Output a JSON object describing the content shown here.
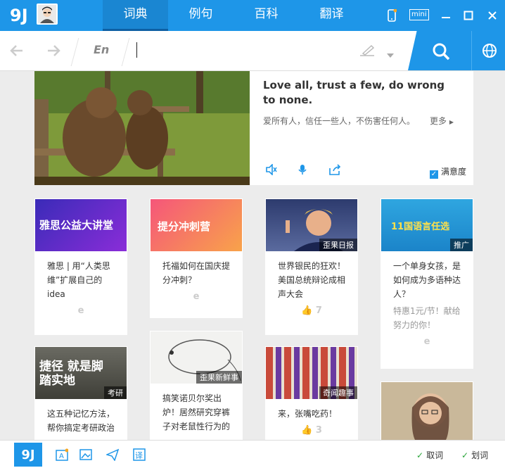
{
  "titlebar": {
    "logo": "9J",
    "tabs": [
      {
        "label": "词典",
        "active": true
      },
      {
        "label": "例句",
        "active": false
      },
      {
        "label": "百科",
        "active": false
      },
      {
        "label": "翻译",
        "active": false
      }
    ],
    "mini_label": "mini"
  },
  "search": {
    "lang_label": "En",
    "value": ""
  },
  "daily": {
    "english": "Love all, trust a few, do wrong to none.",
    "chinese": "爱所有人，信任一些人，不伤害任何人。",
    "more_label": "更多",
    "satisfaction_label": "满意度"
  },
  "cards": [
    {
      "img_text": "雅思公益大讲堂",
      "img_tag": "",
      "title": "雅思 | 用“人类思维”扩展自己的idea",
      "sub": "",
      "foot": "e"
    },
    {
      "img_text": "提分冲刺营",
      "img_tag": "",
      "title": "托福如何在国庆提分冲刺？",
      "sub": "",
      "foot": "e"
    },
    {
      "img_text": "",
      "img_tag": "歪果日报",
      "title": "世界银民的狂欢！美国总统辩论成相声大会",
      "sub": "",
      "foot": "7"
    },
    {
      "img_text": "11国语言任选",
      "img_tag": "推广",
      "title": "一个单身女孩，是如何成为多语种达人？",
      "sub": "特惠1元/节！献给努力的你！",
      "foot": "e"
    },
    {
      "img_text": "捷径 就是脚踏实地",
      "img_tag": "考研",
      "title": "这五种记忆方法，帮你搞定考研政治",
      "sub": "",
      "foot": ""
    },
    {
      "img_text": "",
      "img_tag": "歪果新鲜事",
      "title": "搞笑诺贝尔奖出炉！居然研究穿裤子对老鼠性行为的",
      "sub": "",
      "foot": ""
    },
    {
      "img_text": "",
      "img_tag": "奇闻趣事",
      "title": "来，张嘴吃药！",
      "sub": "",
      "foot": "3"
    },
    {
      "img_text": "",
      "img_tag": "",
      "title": "",
      "sub": "",
      "foot": ""
    }
  ],
  "bottombar": {
    "cancel_label": "取词",
    "select_label": "划词"
  },
  "colors": {
    "accent": "#1e96e8",
    "background": "#ececec"
  }
}
